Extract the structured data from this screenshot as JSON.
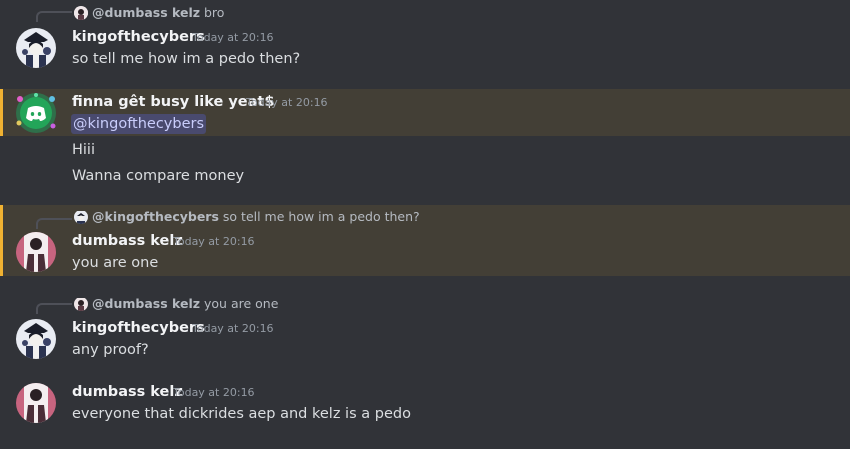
{
  "messages": [
    {
      "reply": {
        "username": "@dumbass kelz",
        "text": "bro"
      },
      "username": "kingofthecybers",
      "timestamp": "Today at 20:16",
      "lines": [
        "so tell me how im a pedo then?"
      ]
    },
    {
      "username": "finna gêt busy like yeat$",
      "timestamp": "Today at 20:16",
      "mention": "@kingofthecybers",
      "lines": [
        "Hiii",
        "Wanna compare money"
      ]
    },
    {
      "reply": {
        "username": "@kingofthecybers",
        "text": "so tell me how im a pedo then?"
      },
      "username": "dumbass kelz",
      "timestamp": "Today at 20:16",
      "lines": [
        "you are one"
      ]
    },
    {
      "reply": {
        "username": "@dumbass kelz",
        "text": "you are one"
      },
      "username": "kingofthecybers",
      "timestamp": "Today at 20:16",
      "lines": [
        "any proof?"
      ]
    },
    {
      "username": "dumbass kelz",
      "timestamp": "Today at 20:16",
      "lines": [
        "everyone that dickrides aep and kelz is a pedo"
      ]
    }
  ],
  "colors": {
    "background": "#313338",
    "highlight": "#433f36",
    "highlight_bar": "#f0b232",
    "discord_blurple": "#5865f2",
    "mention_text": "#c9cdfb"
  }
}
